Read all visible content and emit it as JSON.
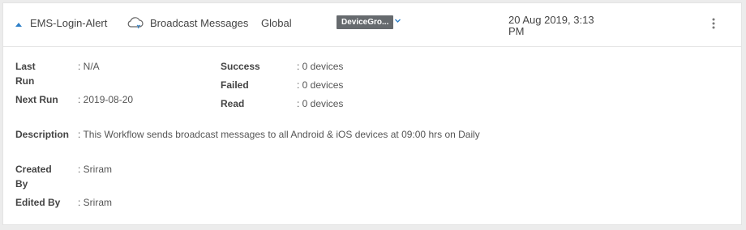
{
  "workflow": {
    "name": "EMS-Login-Alert",
    "type": "Broadcast Messages",
    "scope": "Global",
    "group_badge": "DeviceGro...",
    "date_line1": "20 Aug 2019, 3:13",
    "date_line2": "PM"
  },
  "details": {
    "last_run_label_1": "Last",
    "last_run_label_2": "Run",
    "last_run_value": ": N/A",
    "next_run_label": "Next Run",
    "next_run_value": ": 2019-08-20",
    "success_label": "Success",
    "success_value": ": 0 devices",
    "failed_label": "Failed",
    "failed_value": ": 0 devices",
    "read_label": "Read",
    "read_value": ": 0 devices",
    "description_label": "Description",
    "description_value": ": This Workflow sends broadcast messages to all Android & iOS devices at 09:00 hrs on Daily",
    "created_by_label_1": "Created",
    "created_by_label_2": "By",
    "created_by_value": ": Sriram",
    "edited_by_label": "Edited By",
    "edited_by_value": ": Sriram"
  },
  "colors": {
    "accent": "#2f80c8",
    "badge_bg": "#666a6e"
  },
  "icons": {
    "collapse": "caret-up-icon",
    "type": "cloud-icon",
    "dropdown": "chevron-down-icon",
    "menu": "kebab-menu-icon"
  }
}
